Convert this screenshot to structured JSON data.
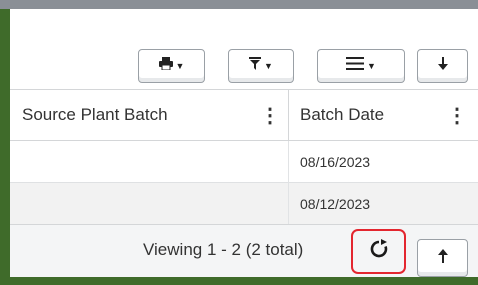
{
  "table": {
    "columns": [
      "Source Plant Batch",
      "Batch Date"
    ],
    "rows": [
      {
        "source_plant_batch": "",
        "batch_date": "08/16/2023"
      },
      {
        "source_plant_batch": "",
        "batch_date": "08/12/2023"
      }
    ]
  },
  "footer": {
    "viewing_text": "Viewing 1 - 2 (2 total)"
  },
  "toolbar": {
    "buttons": [
      {
        "icon": "print-icon",
        "has_caret": true
      },
      {
        "icon": "filter-icon",
        "has_caret": true
      },
      {
        "icon": "columns-menu-icon",
        "has_caret": true
      },
      {
        "icon": "download-icon",
        "has_caret": false
      }
    ]
  },
  "colors": {
    "frame_green": "#3f6b2a",
    "highlight_red": "#e3262f"
  }
}
